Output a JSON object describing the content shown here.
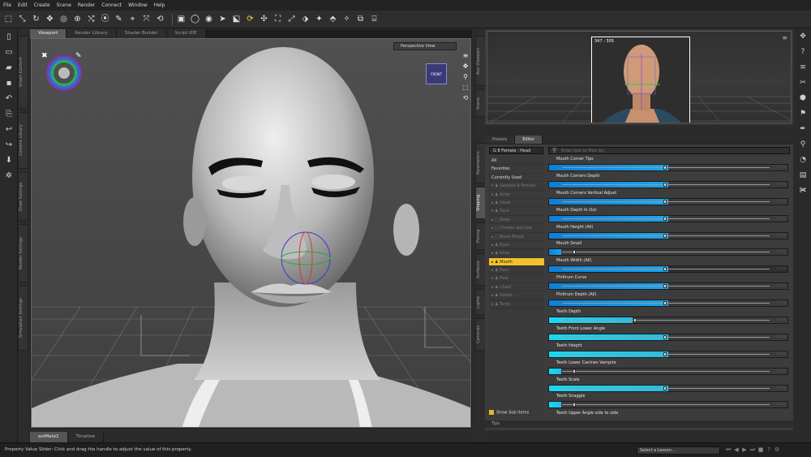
{
  "menu": [
    "File",
    "Edit",
    "Create",
    "Scene",
    "Render",
    "Connect",
    "Window",
    "Help"
  ],
  "toolbar": {
    "icons": [
      "pointer-icon",
      "node-select-icon",
      "rotate-icon",
      "move-icon",
      "scale-icon",
      "universal-icon",
      "joint-editor-icon",
      "surface-selection-icon",
      "geometry-editor-icon",
      "figure-icon",
      "object-icon",
      "morph-icon",
      "camera-icon",
      "circle-icon",
      "bullseye-icon",
      "arrow-select-icon",
      "region-icon",
      "joint-icon",
      "rotate-brush-icon",
      "move-brush-icon",
      "weight-icon",
      "brush-icon",
      "spotlight-icon",
      "node-weight-icon",
      "pose-icon",
      "render-settings-icon",
      "render-icon"
    ]
  },
  "viewport": {
    "tabs": [
      "Viewport",
      "Render Library",
      "Shader Builder",
      "Script IDE"
    ],
    "view_selector": "Perspective View",
    "cube_label": "FRONT"
  },
  "left_tabs": [
    "Smart Content",
    "Content Library",
    "Draw Settings",
    "Render Settings",
    "Simulation Settings"
  ],
  "left_tool_icons": [
    "new-icon",
    "open-icon",
    "merge-icon",
    "save-icon",
    "undo-icon",
    "redo-icon",
    "camera-icon",
    "light-icon",
    "content-icon"
  ],
  "bottom_tabs": [
    "aniMate2",
    "Timeline"
  ],
  "status": {
    "text": "Property Value Slider: Click and drag the handle to adjust the value of this property.",
    "lesson_select": "Select a Lesson..."
  },
  "aux_viewport": {
    "coords": "347 : 305"
  },
  "mid_tabs": [
    "Aux Viewport",
    "Scene",
    "Parameters",
    "Shaping",
    "Posing",
    "Surfaces",
    "Lights",
    "Cameras"
  ],
  "panel": {
    "tabs": [
      "Presets",
      "Editor"
    ],
    "node_selector": "G 8 Female : Head",
    "search_placeholder": "Enter text to filter by...",
    "show_sub_items": "Show Sub Items",
    "tips_tab": "Tips",
    "tree": [
      {
        "label": "All",
        "state": "normal"
      },
      {
        "label": "Favorites",
        "state": "normal"
      },
      {
        "label": "Currently Used",
        "state": "normal"
      },
      {
        "label": "▾ ♟ Genesis 8 Female",
        "state": "dim"
      },
      {
        "label": "  ▸ ♟ Actor",
        "state": "dim"
      },
      {
        "label": "  ▸ ♟ Head",
        "state": "dim"
      },
      {
        "label": "  ▾ ♟ Face",
        "state": "dim"
      },
      {
        "label": "    ▸ ▢ Brow",
        "state": "dim"
      },
      {
        "label": "    ▸ ▢ Cheeks and Jaw",
        "state": "dim"
      },
      {
        "label": "    ▸ ▢ Bone Morph",
        "state": "dim"
      },
      {
        "label": "  ▸ ♟ Eyes",
        "state": "dim"
      },
      {
        "label": "  ▸ ♟ Nose",
        "state": "dim"
      },
      {
        "label": "▸ ♟ Mouth",
        "state": "selected"
      },
      {
        "label": "  ▸ ♟ Ears",
        "state": "dim"
      },
      {
        "label": "  ▸ ♟ Feet",
        "state": "dim"
      },
      {
        "label": "  ▸ ♟ Chest",
        "state": "dim"
      },
      {
        "label": "  ▸ ♟ Hands",
        "state": "dim"
      },
      {
        "label": "  ▸ ♟ Torso",
        "state": "dim"
      }
    ],
    "properties": [
      {
        "label": "Mouth Corner Tips",
        "fill": 0.5,
        "color": "blue"
      },
      {
        "label": "Mouth Corners Depth",
        "fill": 0.5,
        "color": "blue"
      },
      {
        "label": "Mouth Corners Vertical Adjust",
        "fill": 0.5,
        "color": "blue"
      },
      {
        "label": "Mouth Depth In Out",
        "fill": 0.5,
        "color": "blue"
      },
      {
        "label": "Mouth Height (All)",
        "fill": 0.5,
        "color": "blue"
      },
      {
        "label": "Mouth Small",
        "fill": 0.05,
        "color": "blue"
      },
      {
        "label": "Mouth Width (All)",
        "fill": 0.5,
        "color": "blue",
        "active": true
      },
      {
        "label": "Philtrum Curve",
        "fill": 0.5,
        "color": "blue"
      },
      {
        "label": "Philtrum Depth (All)",
        "fill": 0.5,
        "color": "blue"
      },
      {
        "label": "Teeth Depth",
        "fill": 0.35,
        "color": "cyan"
      },
      {
        "label": "Teeth Front Lower Angle",
        "fill": 0.5,
        "color": "cyan"
      },
      {
        "label": "Teeth Height",
        "fill": 0.5,
        "color": "cyan"
      },
      {
        "label": "Teeth Lower Canines Vampire",
        "fill": 0.05,
        "color": "cyan"
      },
      {
        "label": "Teeth Scale",
        "fill": 0.5,
        "color": "cyan"
      },
      {
        "label": "Teeth Snaggle",
        "fill": 0.05,
        "color": "cyan"
      },
      {
        "label": "Teeth Upper Angle side to side",
        "fill": 0.5,
        "color": "cyan"
      }
    ],
    "value_text": "0.0%"
  },
  "right_icons": [
    "layout-icon",
    "help-icon",
    "menu-icon",
    "scissor-icon",
    "shape-icon",
    "chart-icon",
    "paint-icon",
    "bone-icon",
    "render-icon"
  ],
  "colors": {
    "accent_selected": "#f2c22b",
    "slider_blue": "#1aa6f0",
    "slider_cyan": "#1ad8f0"
  }
}
